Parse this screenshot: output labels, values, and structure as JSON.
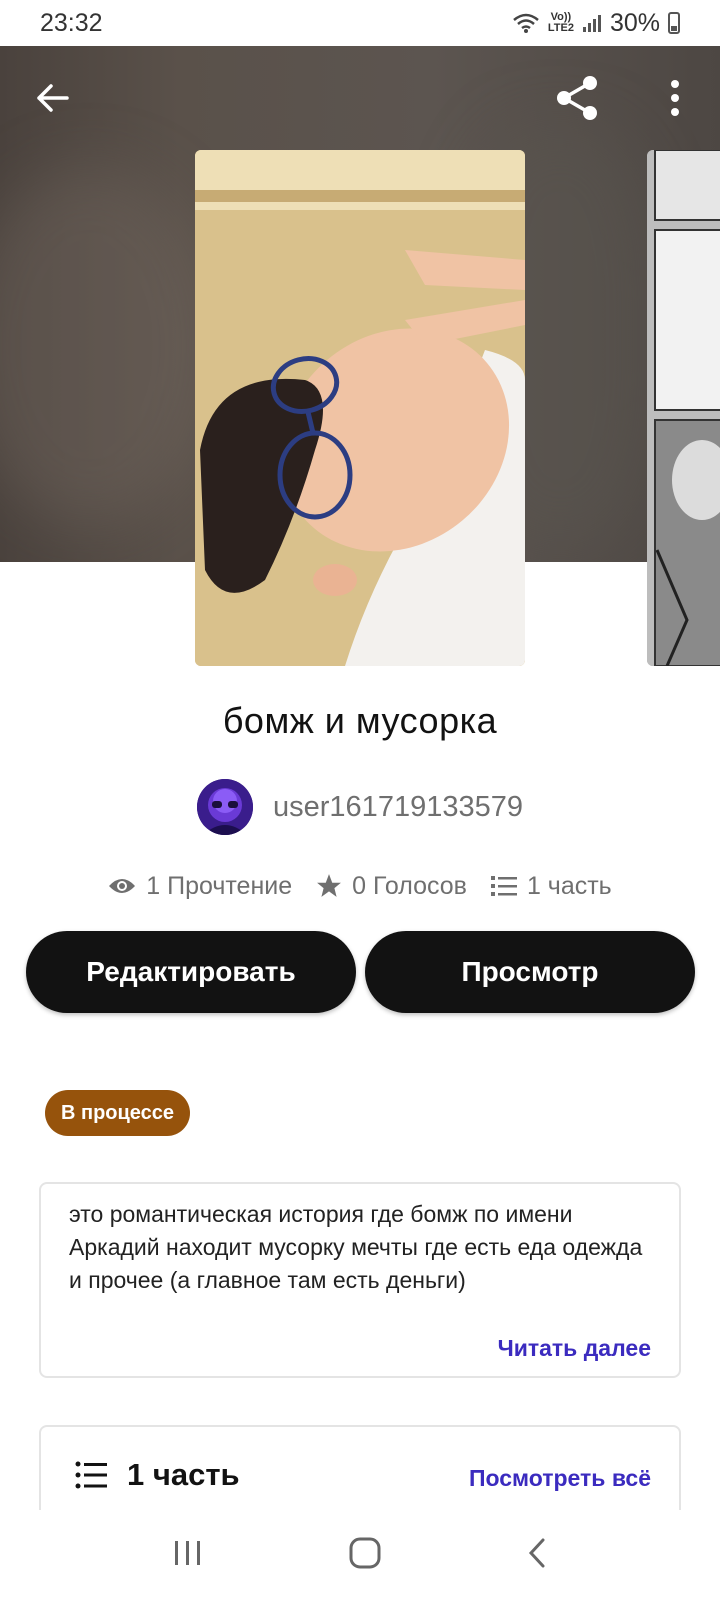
{
  "status_bar": {
    "time": "23:32",
    "network_label_top": "Vo))",
    "network_label_bottom": "LTE2",
    "battery": "30%"
  },
  "icons": {
    "back": "arrow-left-icon",
    "share": "share-icon",
    "more": "more-vertical-icon",
    "views": "eye-icon",
    "votes": "star-icon",
    "parts": "list-icon"
  },
  "story": {
    "title": "бомж и мусорка",
    "author": "user161719133579",
    "stats": {
      "reads": "1 Прочтение",
      "votes": "0 Голосов",
      "parts": "1 часть"
    },
    "status": "В процессе",
    "description": "это романтическая история где бомж по имени Аркадий находит мусорку мечты где есть еда одежда и прочее (а главное там есть деньги)",
    "read_more": "Читать далее"
  },
  "actions": {
    "edit": "Редактировать",
    "preview": "Просмотр"
  },
  "parts_section": {
    "count": "1 часть",
    "see_all": "Посмотреть всё"
  },
  "colors": {
    "button_bg": "#121212",
    "badge_bg": "#96530c",
    "link": "#3b2bbf",
    "muted_text": "#6f6f6f"
  }
}
